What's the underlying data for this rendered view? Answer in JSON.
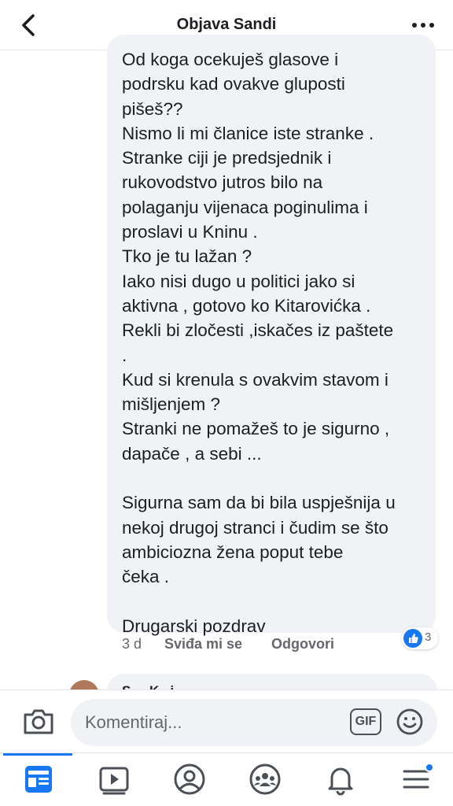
{
  "header": {
    "title": "Objava Sandi"
  },
  "comment": {
    "text": "Od koga ocekuješ glasove i\npodrsku kad ovakve gluposti\npišeš??\nNismo li mi članice iste stranke .\nStranke ciji je predsjednik i\nrukovodstvo jutros bilo na\npolaganju vijenaca poginulima i\nproslavi u Kninu .\nTko je tu lažan ?\nIako nisi dugo u politici jako si\naktivna , gotovo ko Kitarovićka .\nRekli bi zločesti ,iskačes iz paštete\n.\nKud si krenula s ovakvim stavom i\nmišljenjem ?\nStranki ne pomažeš to je sigurno ,\ndapače , a sebi ...\n\nSigurna sam da bi bila uspješnija u\nnekoj drugoj stranci i čudim se što\nambiciozna žena poput tebe\nčeka .\n\nDrugarski pozdrav",
    "time": "3 d",
    "like_label": "Sviđa mi se",
    "reply_label": "Odgovori",
    "reaction_count": "3"
  },
  "next_comment": {
    "name": "S.... K...i..."
  },
  "composer": {
    "placeholder": "Komentiraj...",
    "gif_label": "GIF"
  },
  "colors": {
    "accent": "#1877f2",
    "bubble": "#f0f2f5",
    "secondary_text": "#65676b"
  },
  "icons": [
    "back-chevron-icon",
    "more-dots-icon",
    "camera-icon",
    "gif-icon",
    "emoji-icon",
    "feed-icon",
    "watch-icon",
    "profile-icon",
    "groups-icon",
    "bell-icon",
    "menu-icon",
    "like-icon"
  ]
}
